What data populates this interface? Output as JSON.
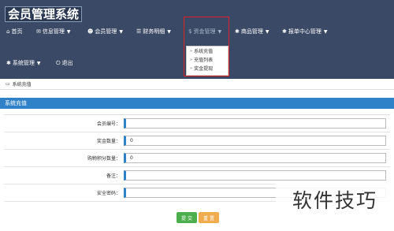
{
  "app": {
    "title": "会员管理系统"
  },
  "nav": {
    "row1": [
      {
        "icon": "home-icon",
        "glyph": "⌂",
        "label": "首页",
        "chevron": false
      },
      {
        "icon": "chat-icon",
        "glyph": "✉",
        "label": "信息管理",
        "chevron": true
      },
      {
        "icon": "users-icon",
        "glyph": "☻",
        "label": "会员管理",
        "chevron": true
      },
      {
        "icon": "list-icon",
        "glyph": "☰",
        "label": "财务明细",
        "chevron": true
      },
      {
        "icon": "dollar-icon",
        "glyph": "$",
        "label": "资金管理",
        "chevron": true
      },
      {
        "icon": "gear-icon",
        "glyph": "✱",
        "label": "商品管理",
        "chevron": true
      },
      {
        "icon": "gear-icon",
        "glyph": "✱",
        "label": "报单中心管理",
        "chevron": true
      }
    ],
    "row2": [
      {
        "icon": "gear-icon",
        "glyph": "✱",
        "label": "系统管理",
        "chevron": true
      },
      {
        "icon": "power-icon",
        "glyph": "⏻",
        "label": "退出",
        "chevron": false
      }
    ]
  },
  "dropdown": {
    "items": [
      "系统充值",
      "充值列表",
      "奖金提现"
    ]
  },
  "breadcrumb": {
    "icon": "card-icon",
    "text": "系统充值"
  },
  "panel": {
    "title": "系统充值"
  },
  "form": {
    "fields": [
      {
        "label": "会员编号：",
        "value": ""
      },
      {
        "label": "奖金数量：",
        "value": "0"
      },
      {
        "label": "购物积分数量：",
        "value": "0"
      },
      {
        "label": "备注：",
        "value": ""
      },
      {
        "label": "安全密码：",
        "value": ""
      }
    ],
    "submit": "提 交",
    "reset": "重 置"
  },
  "watermark": "软件技巧",
  "colors": {
    "topbar": "#3a4a66",
    "panel": "#2f82c8",
    "submit": "#4cae4c",
    "reset": "#f0ad4e",
    "highlight": "#e02020"
  }
}
